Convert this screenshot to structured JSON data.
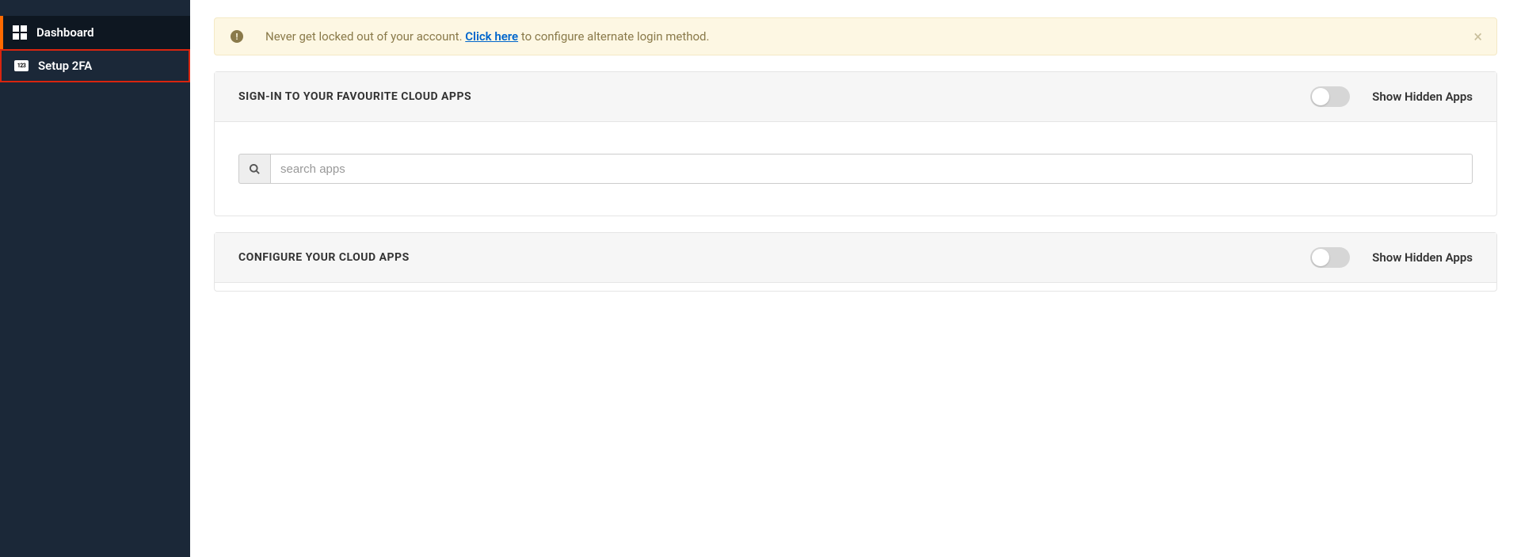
{
  "sidebar": {
    "items": [
      {
        "label": "Dashboard",
        "icon_badge": ""
      },
      {
        "label": "Setup 2FA",
        "icon_badge": "123"
      }
    ]
  },
  "alert": {
    "text_before": "Never get locked out of your account. ",
    "link_text": "Click here",
    "text_after": " to configure alternate login method."
  },
  "panel_signin": {
    "title": "SIGN-IN TO YOUR FAVOURITE CLOUD APPS",
    "toggle_label": "Show Hidden Apps",
    "search_placeholder": "search apps"
  },
  "panel_configure": {
    "title": "CONFIGURE YOUR CLOUD APPS",
    "toggle_label": "Show Hidden Apps"
  }
}
